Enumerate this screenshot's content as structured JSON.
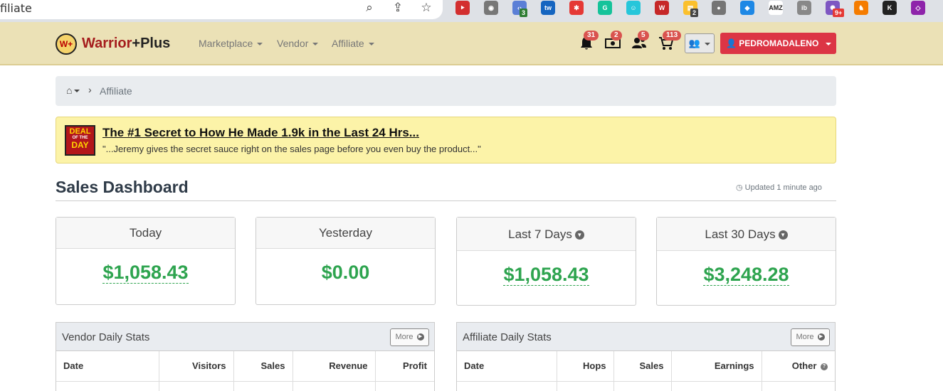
{
  "browser": {
    "url_fragment": "filiate",
    "extensions": [
      {
        "name": "pdf-extension-icon",
        "color": "#d32f2f",
        "glyph": "⯈"
      },
      {
        "name": "film-extension-icon",
        "color": "#777777",
        "glyph": "◉"
      },
      {
        "name": "code-extension-icon",
        "color": "#5b7fd6",
        "glyph": "‹›",
        "badge": "3",
        "badge_color": "#2e7d32"
      },
      {
        "name": "tw-extension-icon",
        "color": "#1565c0",
        "glyph": "tw"
      },
      {
        "name": "color-wheel-extension-icon",
        "color": "#e53935",
        "glyph": "✱"
      },
      {
        "name": "grammarly-extension-icon",
        "color": "#15c39a",
        "glyph": "G"
      },
      {
        "name": "bot-extension-icon",
        "color": "#26c6da",
        "glyph": "☺"
      },
      {
        "name": "word-extension-icon",
        "color": "#c62828",
        "glyph": "W"
      },
      {
        "name": "yellow-extension-icon",
        "color": "#fbc02d",
        "glyph": "▤",
        "badge": "2",
        "badge_color": "#444444"
      },
      {
        "name": "grey-extension-icon",
        "color": "#757575",
        "glyph": "●"
      },
      {
        "name": "tag-extension-icon",
        "color": "#1e88e5",
        "glyph": "◆"
      },
      {
        "name": "amz-extension-icon",
        "color": "#ffffff",
        "glyph": "AMZ"
      },
      {
        "name": "ib-extension-icon",
        "color": "#888888",
        "glyph": "ib"
      },
      {
        "name": "spark-extension-icon",
        "color": "#7e57c2",
        "glyph": "✺",
        "badge": "9+",
        "badge_color": "#e53935"
      },
      {
        "name": "fox-extension-icon",
        "color": "#f57c00",
        "glyph": "♞"
      },
      {
        "name": "k-extension-icon",
        "color": "#222222",
        "glyph": "K"
      },
      {
        "name": "diamond-extension-icon",
        "color": "#8e24aa",
        "glyph": "◇"
      }
    ]
  },
  "navbar": {
    "logo_mark": "W+",
    "brand_part1": "Warrior",
    "brand_part2": "+Plus",
    "menu": [
      "Marketplace",
      "Vendor",
      "Affiliate"
    ],
    "notifications": {
      "bell": "31",
      "money": "2",
      "users": "5",
      "cart": "113"
    },
    "user_label": "PEDROMADALENO"
  },
  "breadcrumb": {
    "current": "Affiliate"
  },
  "deal": {
    "badge_line1": "DEAL",
    "badge_line2": "OF THE",
    "badge_line3": "DAY",
    "title": "The #1 Secret to How He Made 1.9k in the Last 24 Hrs...",
    "subtitle": "\"...Jeremy gives the secret sauce right on the sales page before you even buy the product...\""
  },
  "dashboard": {
    "title": "Sales Dashboard",
    "updated": "Updated 1 minute ago",
    "cards": [
      {
        "label": "Today",
        "value": "$1,058.43"
      },
      {
        "label": "Yesterday",
        "value": "$0.00"
      },
      {
        "label": "Last 7 Days",
        "value": "$1,058.43"
      },
      {
        "label": "Last 30 Days",
        "value": "$3,248.28"
      }
    ]
  },
  "vendor_stats": {
    "title": "Vendor Daily Stats",
    "more": "More",
    "columns": [
      "Date",
      "Visitors",
      "Sales",
      "Revenue",
      "Profit"
    ]
  },
  "affiliate_stats": {
    "title": "Affiliate Daily Stats",
    "more": "More",
    "columns": [
      "Date",
      "Hops",
      "Sales",
      "Earnings",
      "Other"
    ]
  },
  "colors": {
    "navbar_bg": "#ebe1b6",
    "accent_red": "#dc3545",
    "badge_red": "#d9534f",
    "money_green": "#2ea44f",
    "deal_bg": "#fcf3a8"
  }
}
